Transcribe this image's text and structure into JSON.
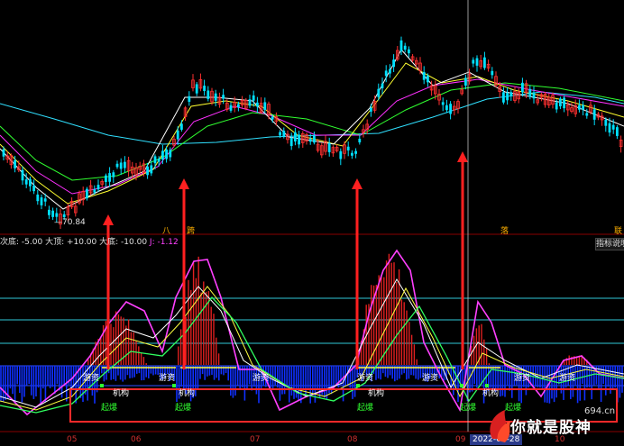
{
  "price_panel": {
    "low_label": "70.84",
    "bottom_marks": [
      "八",
      "跨",
      "落",
      "联"
    ]
  },
  "indicator_panel": {
    "header_parts": [
      {
        "text": "次底: -5.00",
        "color": "#e8e8e8"
      },
      {
        "text": "大顶: +10.00",
        "color": "#e8e8e8"
      },
      {
        "text": "大底: -10.00",
        "color": "#e8e8e8"
      },
      {
        "text": "J: -1.12",
        "color": "#ff40ff"
      }
    ],
    "desc_button": "指标说明",
    "tags_white": [
      "游资",
      "游资",
      "游资",
      "游资",
      "游资",
      "游资",
      "游资"
    ],
    "tags_buy": [
      "机构",
      "机构",
      "机构",
      "机构"
    ],
    "tags_green": [
      "起爆",
      "起爆",
      "起爆",
      "起爆",
      "起爆"
    ]
  },
  "x_axis": {
    "months": [
      "05",
      "06",
      "07",
      "08",
      "09",
      "10"
    ],
    "crosshair_date": "2022-09-28"
  },
  "watermark": {
    "text": "你就是股神",
    "site": "694.cn"
  },
  "colors": {
    "up_candle": "#ff3030",
    "down_candle": "#00e0ff",
    "panel_border": "#8a0000",
    "box": "#ff2a2a",
    "arrow": "#ff2020",
    "cyan_line": "#30e0ff",
    "yellow_line": "#ffff30",
    "magenta_line": "#ff30ff",
    "green_line": "#30ff30",
    "blue_bars": "#1030ff"
  }
}
